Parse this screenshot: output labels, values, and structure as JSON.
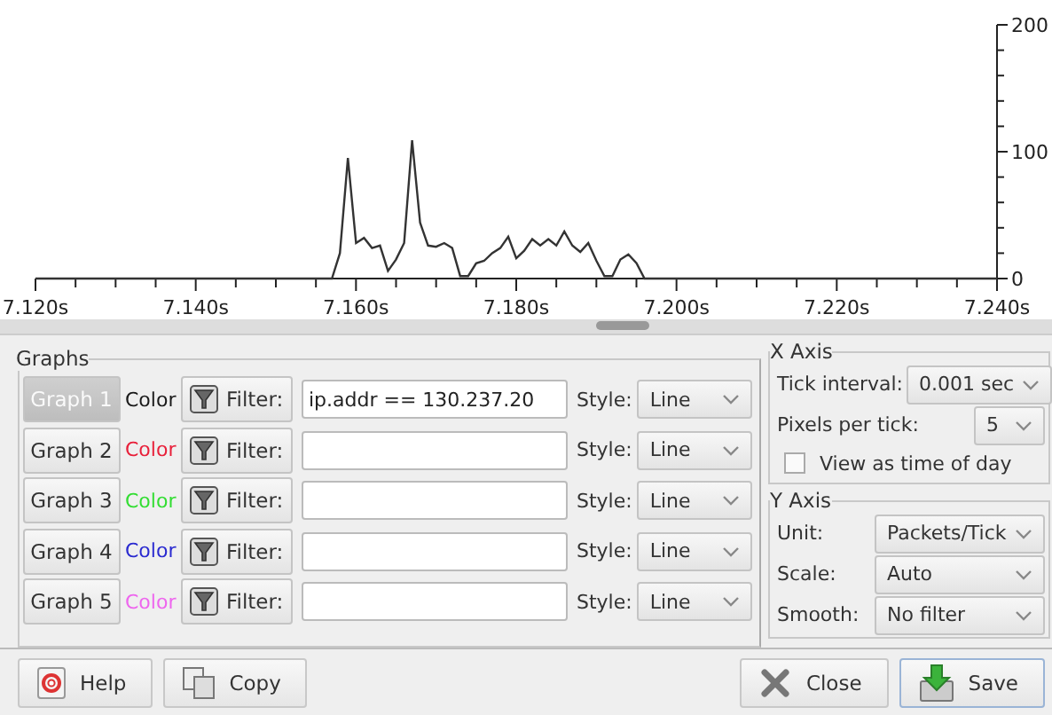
{
  "chart": {
    "chart_data": {
      "type": "line",
      "x": [
        7.12,
        7.157,
        7.158,
        7.159,
        7.16,
        7.161,
        7.162,
        7.163,
        7.164,
        7.165,
        7.166,
        7.167,
        7.168,
        7.169,
        7.17,
        7.171,
        7.172,
        7.173,
        7.174,
        7.175,
        7.176,
        7.177,
        7.178,
        7.179,
        7.18,
        7.181,
        7.182,
        7.183,
        7.184,
        7.185,
        7.186,
        7.187,
        7.188,
        7.189,
        7.19,
        7.191,
        7.192,
        7.193,
        7.194,
        7.195,
        7.196,
        7.24
      ],
      "series": [
        {
          "color": "#333333",
          "values": [
            0,
            0,
            20,
            95,
            28,
            32,
            24,
            26,
            6,
            15,
            28,
            109,
            44,
            26,
            25,
            28,
            24,
            2,
            2,
            12,
            14,
            20,
            24,
            33,
            16,
            22,
            31,
            26,
            31,
            26,
            37,
            26,
            21,
            28,
            14,
            2,
            2,
            15,
            19,
            12,
            0,
            0
          ]
        }
      ],
      "xlim": [
        7.12,
        7.24
      ],
      "ylim": [
        0,
        200
      ],
      "xticks": [
        {
          "value": 7.12,
          "label": "7.120s"
        },
        {
          "value": 7.14,
          "label": "7.140s"
        },
        {
          "value": 7.16,
          "label": "7.160s"
        },
        {
          "value": 7.18,
          "label": "7.180s"
        },
        {
          "value": 7.2,
          "label": "7.200s"
        },
        {
          "value": 7.22,
          "label": "7.220s"
        },
        {
          "value": 7.24,
          "label": "7.240s"
        }
      ],
      "yticks": [
        0,
        100,
        200
      ]
    }
  },
  "graphs": {
    "title": "Graphs",
    "rows": [
      {
        "label": "Graph 1",
        "disabled": true,
        "color_label": "Color",
        "color": "#1a1a1a",
        "filter_label": "Filter:",
        "filter": "ip.addr == 130.237.20",
        "style_label": "Style:",
        "style": "Line"
      },
      {
        "label": "Graph 2",
        "disabled": false,
        "color_label": "Color",
        "color": "#e8203a",
        "filter_label": "Filter:",
        "style_label": "Style:",
        "style": "Line"
      },
      {
        "label": "Graph 3",
        "disabled": false,
        "color_label": "Color",
        "color": "#33dd33",
        "filter_label": "Filter:",
        "style_label": "Style:",
        "style": "Line"
      },
      {
        "label": "Graph 4",
        "disabled": false,
        "color_label": "Color",
        "color": "#2a2ad0",
        "filter_label": "Filter:",
        "style_label": "Style:",
        "style": "Line"
      },
      {
        "label": "Graph 5",
        "disabled": false,
        "color_label": "Color",
        "color": "#ee66ee",
        "filter_label": "Filter:",
        "style_label": "Style:",
        "style": "Line"
      }
    ]
  },
  "x_axis": {
    "title": "X Axis",
    "tick_interval_label": "Tick interval:",
    "tick_interval": "0.001 sec",
    "pixels_per_tick_label": "Pixels per tick:",
    "pixels_per_tick": "5",
    "time_of_day": {
      "label": "View as time of day",
      "checked": false
    }
  },
  "y_axis": {
    "title": "Y Axis",
    "fields": [
      {
        "label": "Unit:",
        "value": "Packets/Tick"
      },
      {
        "label": "Scale:",
        "value": "Auto"
      },
      {
        "label": "Smooth:",
        "value": "No filter"
      }
    ]
  },
  "buttons": [
    {
      "kind": "help",
      "label": "Help"
    },
    {
      "kind": "copy",
      "label": "Copy"
    },
    {
      "kind": "close",
      "label": "Close"
    },
    {
      "kind": "save",
      "label": "Save"
    }
  ]
}
